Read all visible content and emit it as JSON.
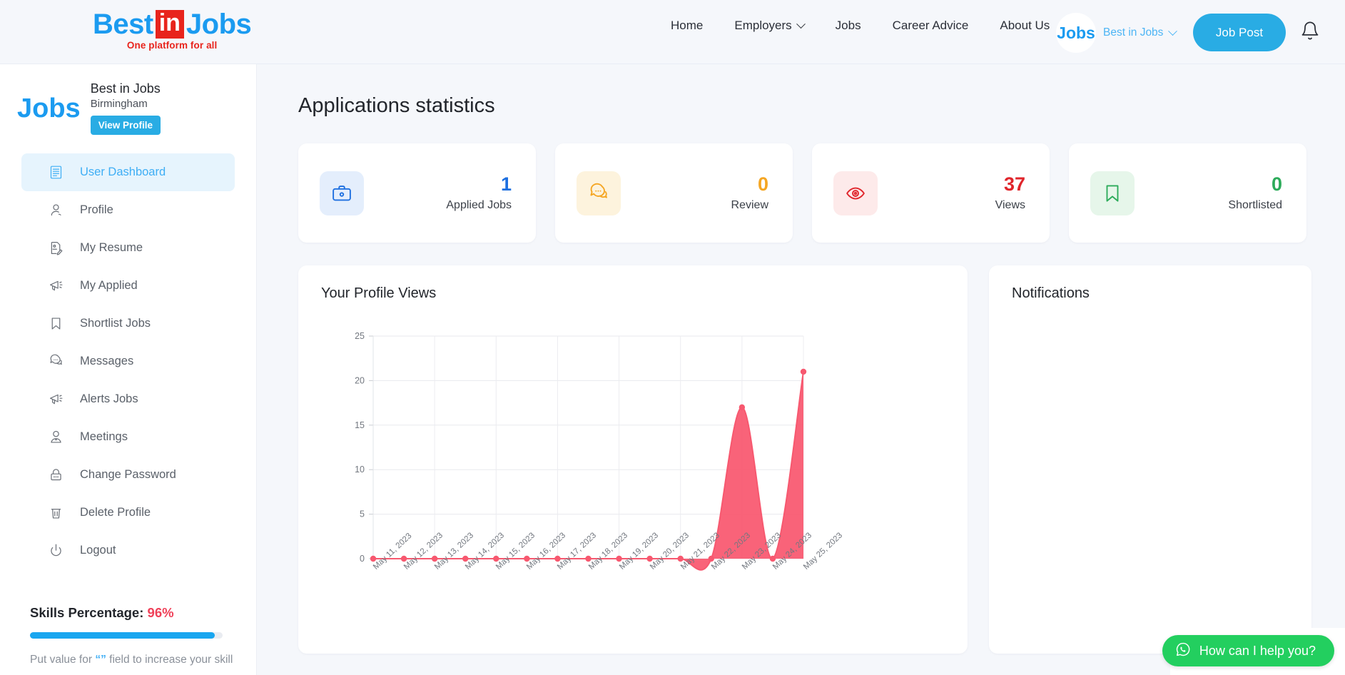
{
  "header": {
    "logo": {
      "part1": "Best",
      "part2": "in",
      "part3": "Jobs",
      "tagline": "One platform for all"
    },
    "nav": [
      {
        "label": "Home",
        "has_dropdown": false
      },
      {
        "label": "Employers",
        "has_dropdown": true
      },
      {
        "label": "Jobs",
        "has_dropdown": false
      },
      {
        "label": "Career Advice",
        "has_dropdown": false
      },
      {
        "label": "About Us",
        "has_dropdown": false
      }
    ],
    "avatar_text": "Jobs",
    "user_name": "Best in Jobs",
    "job_post_label": "Job Post",
    "notification_icon": "bell-icon"
  },
  "sidebar": {
    "avatar_text": "Jobs",
    "profile_name": "Best in Jobs",
    "profile_location": "Birmingham",
    "view_profile_label": "View Profile",
    "items": [
      {
        "label": "User Dashboard",
        "icon": "dashboard-icon",
        "active": true
      },
      {
        "label": "Profile",
        "icon": "user-icon",
        "active": false
      },
      {
        "label": "My Resume",
        "icon": "resume-icon",
        "active": false
      },
      {
        "label": "My Applied",
        "icon": "megaphone-icon",
        "active": false
      },
      {
        "label": "Shortlist Jobs",
        "icon": "bookmark-icon",
        "active": false
      },
      {
        "label": "Messages",
        "icon": "chat-icon",
        "active": false
      },
      {
        "label": "Alerts Jobs",
        "icon": "megaphone-icon",
        "active": false
      },
      {
        "label": "Meetings",
        "icon": "person-tie-icon",
        "active": false
      },
      {
        "label": "Change Password",
        "icon": "lock-icon",
        "active": false
      },
      {
        "label": "Delete Profile",
        "icon": "trash-icon",
        "active": false
      },
      {
        "label": "Logout",
        "icon": "power-icon",
        "active": false
      }
    ],
    "skills": {
      "label": "Skills Percentage:",
      "percent": "96%",
      "progress": 96,
      "hint_before": "Put value for ",
      "hint_quote": "“”",
      "hint_after": " field to increase your skill"
    }
  },
  "main": {
    "page_title": "Applications statistics",
    "cards": [
      {
        "value": "1",
        "label": "Applied Jobs",
        "icon": "briefcase-icon",
        "color": "#1d6fe0",
        "bg": "#e4eefc"
      },
      {
        "value": "0",
        "label": "Review",
        "icon": "chat-icon",
        "color": "#f5a623",
        "bg": "#fdf3dd"
      },
      {
        "value": "37",
        "label": "Views",
        "icon": "eye-icon",
        "color": "#e0252b",
        "bg": "#fdeaea"
      },
      {
        "value": "0",
        "label": "Shortlisted",
        "icon": "bookmark-icon",
        "color": "#2cab5a",
        "bg": "#e6f6ea"
      }
    ],
    "chart_panel_title": "Your Profile Views",
    "notifications_panel_title": "Notifications"
  },
  "chat_widget": {
    "label": "How can I help you?",
    "icon": "whatsapp-icon",
    "color": "#23cf5f"
  },
  "chart_data": {
    "type": "area",
    "title": "Your Profile Views",
    "xlabel": "",
    "ylabel": "",
    "ylim": [
      0,
      25
    ],
    "yticks": [
      0,
      5,
      10,
      15,
      20,
      25
    ],
    "grid": true,
    "legend": false,
    "line_color": "#f7586f",
    "fill_color": "#f8566e",
    "categories": [
      "May 11, 2023",
      "May 12, 2023",
      "May 13, 2023",
      "May 14, 2023",
      "May 15, 2023",
      "May 16, 2023",
      "May 17, 2023",
      "May 18, 2023",
      "May 19, 2023",
      "May 20, 2023",
      "May 21, 2023",
      "May 22, 2023",
      "May 23, 2023",
      "May 24, 2023",
      "May 25, 2023"
    ],
    "values": [
      0,
      0,
      0,
      0,
      0,
      0,
      0,
      0,
      0,
      0,
      0,
      0,
      17,
      0,
      21
    ]
  }
}
